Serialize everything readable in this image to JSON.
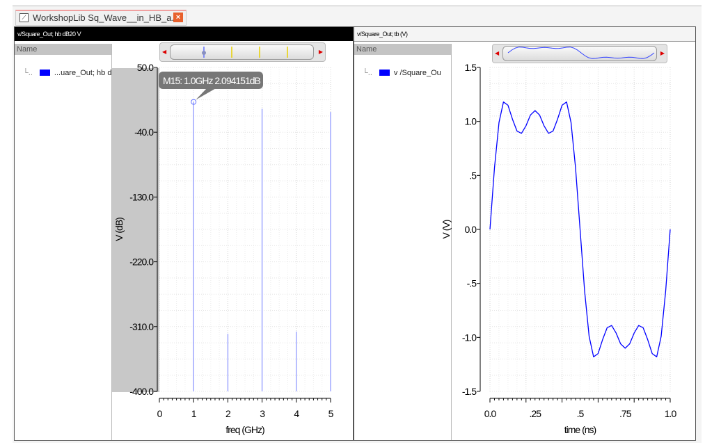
{
  "tab": {
    "title": "WorkshopLib Sq_Wave__in_HB_a...",
    "close_icon": "close-icon",
    "doc_icon": "waveform-window-icon"
  },
  "left_panel": {
    "header": "v/Square_Out; hb dB20 V",
    "name_header": "Name",
    "trace_label": "...uare_Out; hb d",
    "trace_color": "#0000ff",
    "marker_label": "M15: 1.0GHz 2.094151dB"
  },
  "right_panel": {
    "header": "v/Square_Out; tb (V)",
    "name_header": "Name",
    "trace_label": "v /Square_Ou",
    "trace_color": "#0000ff"
  },
  "chart_data": [
    {
      "type": "bar",
      "title": "",
      "xlabel": "freq (GHz)",
      "ylabel": "V (dB)",
      "xlim": [
        0,
        5
      ],
      "ylim": [
        -400,
        50
      ],
      "x_ticks": [
        "0",
        "1",
        "2",
        "3",
        "4",
        "5"
      ],
      "y_ticks": [
        "50.0",
        "-40.0",
        "-130.0",
        "-220.0",
        "-310.0",
        "-400.0"
      ],
      "grid": true,
      "x": [
        1,
        2,
        3,
        4,
        5
      ],
      "values": [
        2.094151,
        -320,
        -7.4,
        -317,
        -11.9
      ],
      "marker": {
        "name": "M15",
        "x": 1.0,
        "y": 2.094151
      }
    },
    {
      "type": "line",
      "title": "",
      "xlabel": "time (ns)",
      "ylabel": "V (V)",
      "xlim": [
        0,
        1.0
      ],
      "ylim": [
        -1.5,
        1.5
      ],
      "x_ticks": [
        "0.0",
        ".25",
        ".5",
        ".75",
        "1.0"
      ],
      "y_ticks": [
        "1.5",
        "1.0",
        ".5",
        "0.0",
        "-.5",
        "-1.0",
        "-1.5"
      ],
      "grid": true,
      "x": [
        0,
        0.025,
        0.05,
        0.075,
        0.1,
        0.125,
        0.15,
        0.175,
        0.2,
        0.225,
        0.25,
        0.275,
        0.3,
        0.325,
        0.35,
        0.375,
        0.4,
        0.425,
        0.45,
        0.475,
        0.5,
        0.525,
        0.55,
        0.575,
        0.6,
        0.625,
        0.65,
        0.675,
        0.7,
        0.725,
        0.75,
        0.775,
        0.8,
        0.825,
        0.85,
        0.875,
        0.9,
        0.925,
        0.95,
        0.975,
        1.0
      ],
      "y": [
        0,
        0.57,
        0.99,
        1.18,
        1.15,
        1.02,
        0.91,
        0.89,
        0.96,
        1.06,
        1.1,
        1.06,
        0.96,
        0.89,
        0.91,
        1.02,
        1.15,
        1.18,
        0.99,
        0.57,
        0,
        -0.57,
        -0.99,
        -1.18,
        -1.15,
        -1.02,
        -0.91,
        -0.89,
        -0.96,
        -1.06,
        -1.1,
        -1.06,
        -0.96,
        -0.89,
        -0.91,
        -1.02,
        -1.15,
        -1.18,
        -0.99,
        -0.57,
        0
      ]
    }
  ]
}
